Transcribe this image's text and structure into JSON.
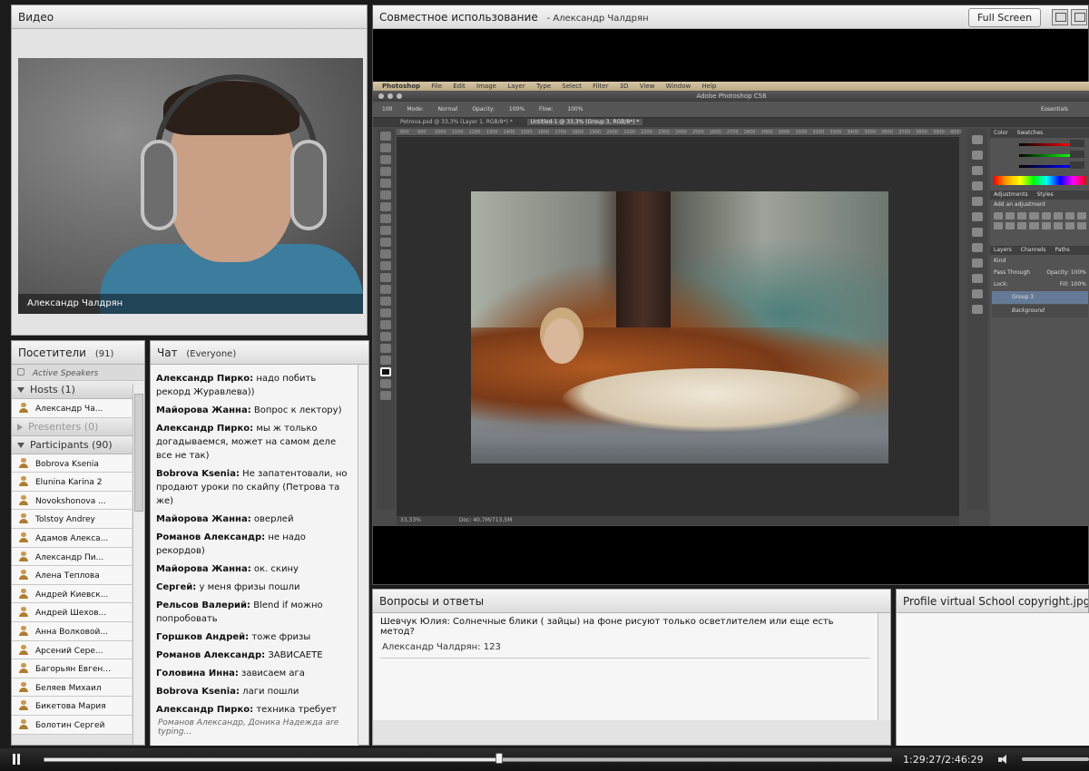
{
  "video": {
    "title": "Видео",
    "presenter_name": "Александр Чалдрян"
  },
  "share": {
    "title": "Совместное использование",
    "presenter": "- Александр Чалдрян",
    "fullscreen_label": "Full Screen",
    "photoshop": {
      "menu": [
        "Photoshop",
        "File",
        "Edit",
        "Image",
        "Layer",
        "Type",
        "Select",
        "Filter",
        "3D",
        "View",
        "Window",
        "Help"
      ],
      "window_title": "Adobe Photoshop CS6",
      "options": [
        "Mode:",
        "Normal",
        "Opacity:",
        "100%",
        "Flow:",
        "100%"
      ],
      "brush_size": "100",
      "workspace": "Essentials",
      "tabs": [
        "Petrova.psd @ 33,3% (Layer 1, RGB/8*) *",
        "Untitled-1 @ 33,3% (Group 3, RGB/8*) *"
      ],
      "ruler": [
        "800",
        "900",
        "1000",
        "1100",
        "1200",
        "1300",
        "1400",
        "1500",
        "1600",
        "1700",
        "1800",
        "1900",
        "2000",
        "2100",
        "2200",
        "2300",
        "2400",
        "2500",
        "2600",
        "2700",
        "2800",
        "2900",
        "3000",
        "3100",
        "3200",
        "3300",
        "3400",
        "3500",
        "3600",
        "3700",
        "3800",
        "3900",
        "4000"
      ],
      "zoom": "33,33%",
      "doc_size": "Doc: 40,7M/713,5M",
      "panel_tabs_color": [
        "Color",
        "Swatches"
      ],
      "panel_tabs_adj": [
        "Adjustments",
        "Styles"
      ],
      "add_adjustment": "Add an adjustment",
      "panel_tabs_layers": [
        "Layers",
        "Channels",
        "Paths"
      ],
      "kind": "Kind",
      "blend_mode": "Pass Through",
      "opacity_label": "Opacity:",
      "opacity_value": "100%",
      "lock_label": "Lock:",
      "fill_label": "Fill:",
      "fill_value": "100%",
      "layers": [
        "Group 3",
        "Background"
      ]
    }
  },
  "attendees": {
    "title": "Посетители",
    "count": "(91)",
    "active_speakers": "Active Speakers",
    "hosts_label": "Hosts (1)",
    "host_name": "Александр Ча...",
    "presenters_label": "Presenters (0)",
    "participants_label": "Participants (90)",
    "participants": [
      "Bobrova Ksenia",
      "Elunina Karina 2",
      "Novokshonova ...",
      "Tolstoy Andrey",
      "Адамов Алекса...",
      "Александр Пи...",
      "Алена Теплова",
      "Андрей Киевск...",
      "Андрей Шехов...",
      "Анна Волковой...",
      "Арсений Сере...",
      "Багорьян Евген...",
      "Беляев Михаил",
      "Бикетова Мария",
      "Болотин Сергей"
    ]
  },
  "chat": {
    "title": "Чат",
    "scope": "(Everyone)",
    "messages": [
      {
        "author": "Александр Пирко:",
        "text": "надо побить рекорд Журавлева))"
      },
      {
        "author": "Майорова Жанна:",
        "text": "Вопрос к лектору)"
      },
      {
        "author": "Александр Пирко:",
        "text": "мы ж только догадываемся, может на самом деле все не так)"
      },
      {
        "author": "Bobrova Ksenia:",
        "text": "Не запатентовали, но продают уроки по скайпу (Петрова та же)"
      },
      {
        "author": "Майорова Жанна:",
        "text": "оверлей"
      },
      {
        "author": "Романов Александр:",
        "text": "не надо рекордов)"
      },
      {
        "author": "Майорова Жанна:",
        "text": "ок. скину"
      },
      {
        "author": "Сергей:",
        "text": "у меня фризы пошли"
      },
      {
        "author": "Рельсов Валерий:",
        "text": "Blend if можно попробовать"
      },
      {
        "author": "Горшков Андрей:",
        "text": "тоже фризы"
      },
      {
        "author": "Романов Александр:",
        "text": "ЗАВИСАЕТЕ"
      },
      {
        "author": "Головина Инна:",
        "text": "зависаем ага"
      },
      {
        "author": "Bobrova Ksenia:",
        "text": "лаги пошли"
      },
      {
        "author": "Александр Пирко:",
        "text": "техника требует перерыва)"
      }
    ],
    "typing": "Романов Александр, Доника Надежда are typing..."
  },
  "qa": {
    "title": "Вопросы и ответы",
    "question": "Шевчук Юлия: Солнечные блики ( зайцы) на фоне рисуют только осветлителем или еще есть метод?",
    "answer": "Александр Чалдрян: 123"
  },
  "copyright": {
    "title": "Profile virtual School copyright.jpg"
  },
  "playback": {
    "time": "1:29:27/2:46:29",
    "progress": 0.537
  },
  "colors": {
    "accent_selected_layer": "#657a96",
    "shirt": "#3c7c9d"
  }
}
